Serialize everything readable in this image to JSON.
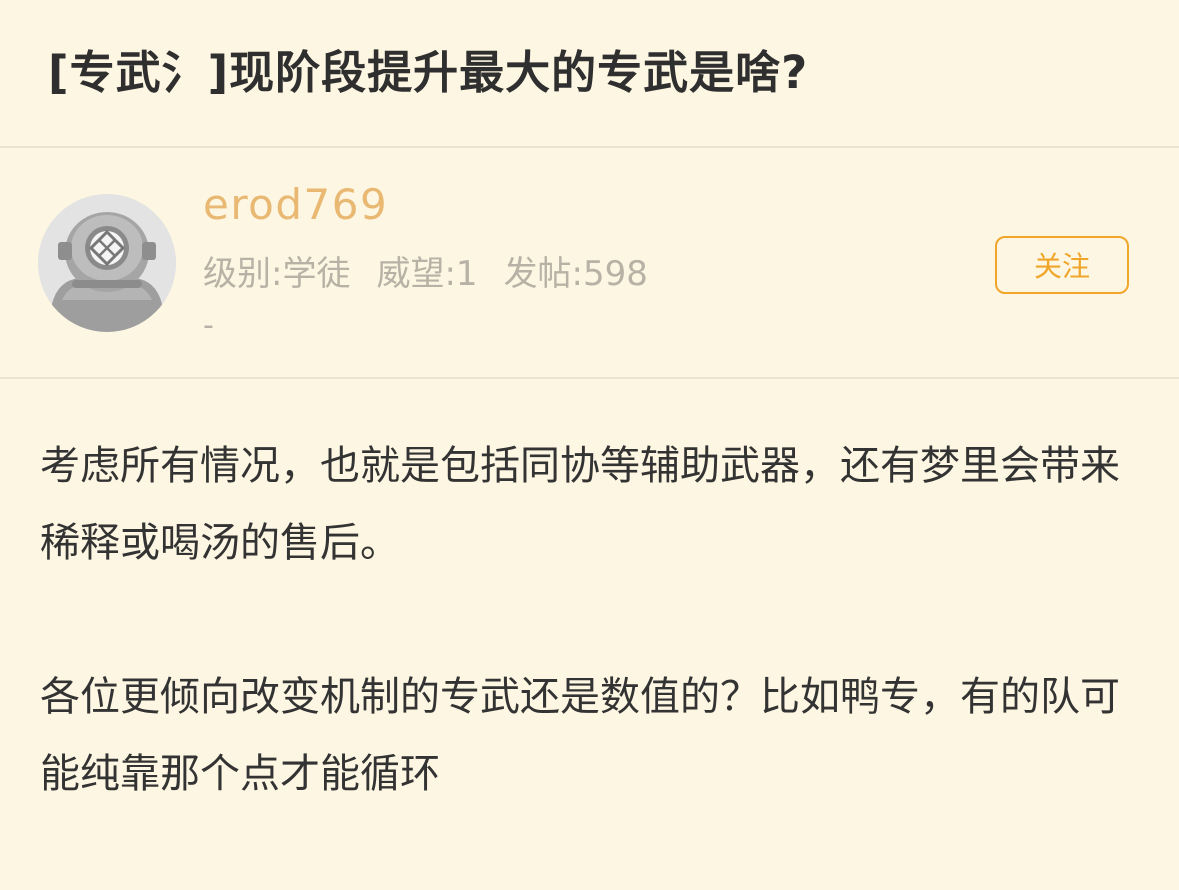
{
  "post": {
    "title": "[专武氵]现阶段提升最大的专武是啥?"
  },
  "author": {
    "username": "erod769",
    "level_label": "级别:学徒",
    "prestige_label": "威望:1",
    "posts_label": "发帖:598",
    "signature": "-",
    "avatar_icon": "diving-helmet-icon",
    "follow_label": "关注"
  },
  "content": {
    "paragraphs": [
      "考虑所有情况，也就是包括同协等辅助武器，还有梦里会带来稀释或喝汤的售后。",
      "各位更倾向改变机制的专武还是数值的？比如鸭专，有的队可能纯靠那个点才能循环"
    ]
  },
  "colors": {
    "background": "#fdf6e2",
    "username": "#e9b873",
    "accent": "#f0a62a",
    "muted": "#b8b2a6",
    "divider": "#ece4ce"
  }
}
